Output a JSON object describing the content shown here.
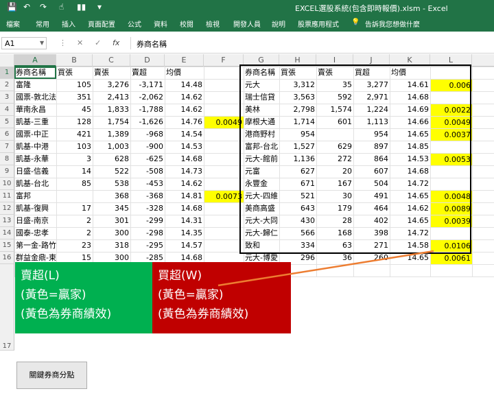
{
  "window": {
    "title": "EXCEL選股系統(包含即時報價).xlsm - Excel"
  },
  "ribbon": {
    "tabs": [
      "檔案",
      "常用",
      "插入",
      "頁面配置",
      "公式",
      "資料",
      "校閱",
      "檢視",
      "開發人員",
      "說明",
      "股票應用程式"
    ],
    "tell_me": "告訴我您想做什麼"
  },
  "formula_bar": {
    "name_box": "A1",
    "formula": "券商名稱"
  },
  "columns": [
    "A",
    "B",
    "C",
    "D",
    "E",
    "F",
    "G",
    "H",
    "I",
    "J",
    "K",
    "L"
  ],
  "rows": [
    "1",
    "2",
    "3",
    "4",
    "5",
    "6",
    "7",
    "8",
    "9",
    "10",
    "11",
    "12",
    "13",
    "14",
    "15",
    "16",
    "17"
  ],
  "left_table": {
    "headers": [
      "券商名稱",
      "買張",
      "賣張",
      "賣超",
      "均價"
    ],
    "rows": [
      {
        "name": "富隆",
        "buy": "105",
        "sell": "3,276",
        "net": "-3,171",
        "avg": "14.48",
        "perf": ""
      },
      {
        "name": "國票-敦北法人",
        "buy": "351",
        "sell": "2,413",
        "net": "-2,062",
        "avg": "14.62",
        "perf": ""
      },
      {
        "name": "華南永昌",
        "buy": "45",
        "sell": "1,833",
        "net": "-1,788",
        "avg": "14.62",
        "perf": ""
      },
      {
        "name": "凱基-三重",
        "buy": "128",
        "sell": "1,754",
        "net": "-1,626",
        "avg": "14.76",
        "perf": "0.0049"
      },
      {
        "name": "國票-中正",
        "buy": "421",
        "sell": "1,389",
        "net": "-968",
        "avg": "14.54",
        "perf": ""
      },
      {
        "name": "凱基-中港",
        "buy": "103",
        "sell": "1,003",
        "net": "-900",
        "avg": "14.53",
        "perf": ""
      },
      {
        "name": "凱基-永華",
        "buy": "3",
        "sell": "628",
        "net": "-625",
        "avg": "14.68",
        "perf": ""
      },
      {
        "name": "日盛-信義",
        "buy": "14",
        "sell": "522",
        "net": "-508",
        "avg": "14.73",
        "perf": ""
      },
      {
        "name": "凱基-台北",
        "buy": "85",
        "sell": "538",
        "net": "-453",
        "avg": "14.62",
        "perf": ""
      },
      {
        "name": "富邦",
        "buy": "",
        "sell": "368",
        "net": "-368",
        "avg": "14.81",
        "perf": "0.0073"
      },
      {
        "name": "凱基-復興",
        "buy": "17",
        "sell": "345",
        "net": "-328",
        "avg": "14.68",
        "perf": ""
      },
      {
        "name": "日盛-南京",
        "buy": "2",
        "sell": "301",
        "net": "-299",
        "avg": "14.31",
        "perf": ""
      },
      {
        "name": "國泰-忠孝",
        "buy": "2",
        "sell": "300",
        "net": "-298",
        "avg": "14.35",
        "perf": ""
      },
      {
        "name": "第一金-路竹",
        "buy": "23",
        "sell": "318",
        "net": "-295",
        "avg": "14.57",
        "perf": ""
      },
      {
        "name": "群益金鼎-東",
        "buy": "15",
        "sell": "300",
        "net": "-285",
        "avg": "14.68",
        "perf": ""
      }
    ]
  },
  "right_table": {
    "headers": [
      "券商名稱",
      "買張",
      "賣張",
      "買超",
      "均價"
    ],
    "rows": [
      {
        "name": "元大",
        "buy": "3,312",
        "sell": "35",
        "net": "3,277",
        "avg": "14.61",
        "perf": "0.006"
      },
      {
        "name": "瑞士信貸",
        "buy": "3,563",
        "sell": "592",
        "net": "2,971",
        "avg": "14.68",
        "perf": ""
      },
      {
        "name": "美林",
        "buy": "2,798",
        "sell": "1,574",
        "net": "1,224",
        "avg": "14.69",
        "perf": "0.0022"
      },
      {
        "name": "摩根大通",
        "buy": "1,714",
        "sell": "601",
        "net": "1,113",
        "avg": "14.66",
        "perf": "0.0049"
      },
      {
        "name": "港商野村",
        "buy": "954",
        "sell": "",
        "net": "954",
        "avg": "14.65",
        "perf": "0.0037"
      },
      {
        "name": "富邦-台北",
        "buy": "1,527",
        "sell": "629",
        "net": "897",
        "avg": "14.85",
        "perf": ""
      },
      {
        "name": "元大-館前",
        "buy": "1,136",
        "sell": "272",
        "net": "864",
        "avg": "14.53",
        "perf": "0.0053"
      },
      {
        "name": "元富",
        "buy": "627",
        "sell": "20",
        "net": "607",
        "avg": "14.68",
        "perf": ""
      },
      {
        "name": "永豐金",
        "buy": "671",
        "sell": "167",
        "net": "504",
        "avg": "14.72",
        "perf": ""
      },
      {
        "name": "元大-四維",
        "buy": "521",
        "sell": "30",
        "net": "491",
        "avg": "14.65",
        "perf": "0.0048"
      },
      {
        "name": "美商高盛",
        "buy": "643",
        "sell": "179",
        "net": "464",
        "avg": "14.62",
        "perf": "0.0089"
      },
      {
        "name": "元大-大同",
        "buy": "430",
        "sell": "28",
        "net": "402",
        "avg": "14.65",
        "perf": "0.0039"
      },
      {
        "name": "元大-歸仁",
        "buy": "566",
        "sell": "168",
        "net": "398",
        "avg": "14.72",
        "perf": ""
      },
      {
        "name": "致和",
        "buy": "334",
        "sell": "63",
        "net": "271",
        "avg": "14.58",
        "perf": "0.0106"
      },
      {
        "name": "元大-博愛",
        "buy": "296",
        "sell": "36",
        "net": "260",
        "avg": "14.65",
        "perf": "0.0061"
      }
    ]
  },
  "labels": {
    "green": [
      "賣超(L)",
      "(黃色=贏家)",
      "(黃色為券商績效)"
    ],
    "red": [
      "買超(W)",
      "(黃色=贏家)",
      "(黃色為券商績效)"
    ]
  },
  "button": {
    "label": "關鍵券商分點"
  },
  "colors": {
    "excel_green": "#217346",
    "label_green": "#00b050",
    "label_red": "#c00000",
    "highlight": "#ffff00",
    "arrow": "#ed7d31"
  }
}
